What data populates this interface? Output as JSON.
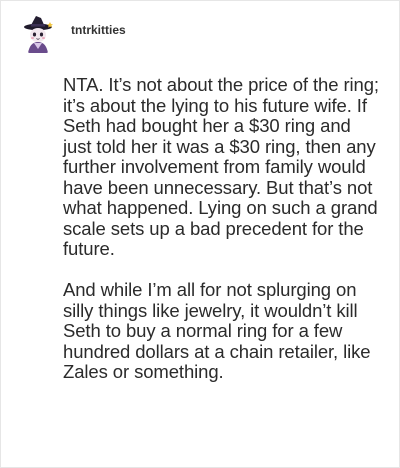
{
  "post": {
    "username": "tntrkitties",
    "avatar_icon": "witch-cat-avatar-icon",
    "paragraphs": [
      "NTA. It’s not about the price of the ring; it’s about the lying to his future wife. If Seth had bought her a $30 ring and just told her it was a $30 ring, then any further involvement from family would have been unnecessary. But that’s not what happened. Lying on such a grand scale sets up a bad precedent for the future.",
      "And while I’m all for not splurging on silly things like jewelry, it wouldn’t kill Seth to buy a normal ring for a few hundred dollars at a chain retailer, like Zales or something."
    ]
  }
}
